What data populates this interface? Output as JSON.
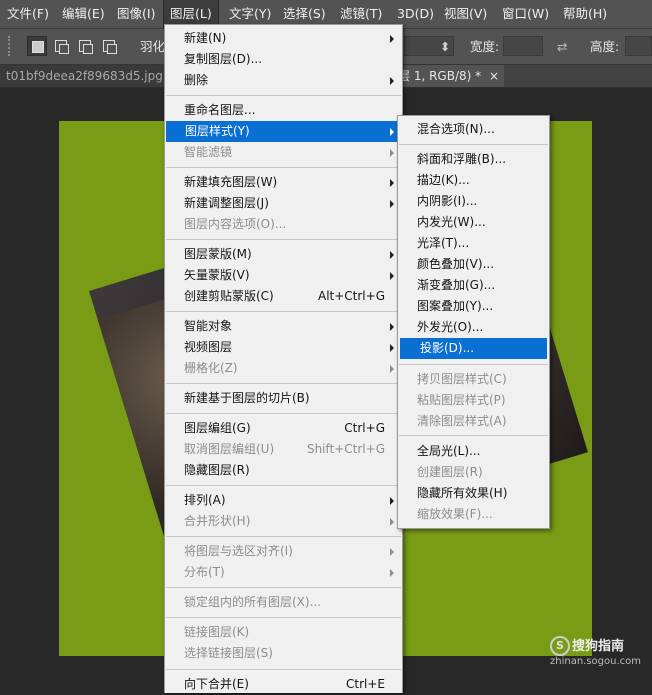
{
  "menubar": {
    "items": [
      "文件(F)",
      "编辑(E)",
      "图像(I)",
      "图层(L)",
      "文字(Y)",
      "选择(S)",
      "滤镜(T)",
      "3D(D)",
      "视图(V)",
      "窗口(W)",
      "帮助(H)"
    ]
  },
  "optionsbar": {
    "feather_label": "羽化",
    "width_label": "宽度:",
    "height_label": "高度:"
  },
  "tabs": {
    "inactive_title": "t01bf9deea2f89683d5.jpg @",
    "active_title": "层 1, RGB/8) *",
    "close_glyph": "×"
  },
  "layer_menu": {
    "items": [
      {
        "label": "新建(N)",
        "submenu": true,
        "disabled": false
      },
      {
        "label": "复制图层(D)...",
        "disabled": false
      },
      {
        "label": "删除",
        "submenu": true,
        "disabled": false
      },
      {
        "label": "重命名图层...",
        "disabled": false
      },
      {
        "label": "图层样式(Y)",
        "submenu": true,
        "disabled": false,
        "highlighted": true
      },
      {
        "label": "智能滤镜",
        "submenu": true,
        "disabled": true
      },
      {
        "label": "新建填充图层(W)",
        "submenu": true,
        "disabled": false
      },
      {
        "label": "新建调整图层(J)",
        "submenu": true,
        "disabled": false
      },
      {
        "label": "图层内容选项(O)...",
        "disabled": true
      },
      {
        "label": "图层蒙版(M)",
        "submenu": true,
        "disabled": false
      },
      {
        "label": "矢量蒙版(V)",
        "submenu": true,
        "disabled": false
      },
      {
        "label": "创建剪贴蒙版(C)",
        "shortcut": "Alt+Ctrl+G",
        "disabled": false
      },
      {
        "label": "智能对象",
        "submenu": true,
        "disabled": false
      },
      {
        "label": "视频图层",
        "submenu": true,
        "disabled": false
      },
      {
        "label": "栅格化(Z)",
        "submenu": true,
        "disabled": true
      },
      {
        "label": "新建基于图层的切片(B)",
        "disabled": false
      },
      {
        "label": "图层编组(G)",
        "shortcut": "Ctrl+G",
        "disabled": false
      },
      {
        "label": "取消图层编组(U)",
        "shortcut": "Shift+Ctrl+G",
        "disabled": true
      },
      {
        "label": "隐藏图层(R)",
        "disabled": false
      },
      {
        "label": "排列(A)",
        "submenu": true,
        "disabled": false
      },
      {
        "label": "合并形状(H)",
        "submenu": true,
        "disabled": true
      },
      {
        "label": "将图层与选区对齐(I)",
        "submenu": true,
        "disabled": true
      },
      {
        "label": "分布(T)",
        "submenu": true,
        "disabled": true
      },
      {
        "label": "锁定组内的所有图层(X)...",
        "disabled": true
      },
      {
        "label": "链接图层(K)",
        "disabled": true
      },
      {
        "label": "选择链接图层(S)",
        "disabled": true
      },
      {
        "label": "向下合并(E)",
        "shortcut": "Ctrl+E",
        "disabled": false
      }
    ]
  },
  "style_submenu": {
    "items": [
      {
        "label": "混合选项(N)...",
        "disabled": false
      },
      {
        "label": "斜面和浮雕(B)...",
        "disabled": false
      },
      {
        "label": "描边(K)...",
        "disabled": false
      },
      {
        "label": "内阴影(I)...",
        "disabled": false
      },
      {
        "label": "内发光(W)...",
        "disabled": false
      },
      {
        "label": "光泽(T)...",
        "disabled": false
      },
      {
        "label": "颜色叠加(V)...",
        "disabled": false
      },
      {
        "label": "渐变叠加(G)...",
        "disabled": false
      },
      {
        "label": "图案叠加(Y)...",
        "disabled": false
      },
      {
        "label": "外发光(O)...",
        "disabled": false
      },
      {
        "label": "投影(D)...",
        "disabled": false,
        "highlighted": true
      },
      {
        "label": "拷贝图层样式(C)",
        "disabled": true
      },
      {
        "label": "粘贴图层样式(P)",
        "disabled": true
      },
      {
        "label": "清除图层样式(A)",
        "disabled": true
      },
      {
        "label": "全局光(L)...",
        "disabled": false
      },
      {
        "label": "创建图层(R)",
        "disabled": true
      },
      {
        "label": "隐藏所有效果(H)",
        "disabled": false
      },
      {
        "label": "缩放效果(F)...",
        "disabled": true
      }
    ]
  },
  "watermark": {
    "icon_glyph": "S",
    "brand": "搜狗指南",
    "url": "zhinan.sogou.com"
  },
  "colors": {
    "canvas": "#799b15",
    "highlight": "#0a6fd2",
    "menubar": "#535353"
  }
}
